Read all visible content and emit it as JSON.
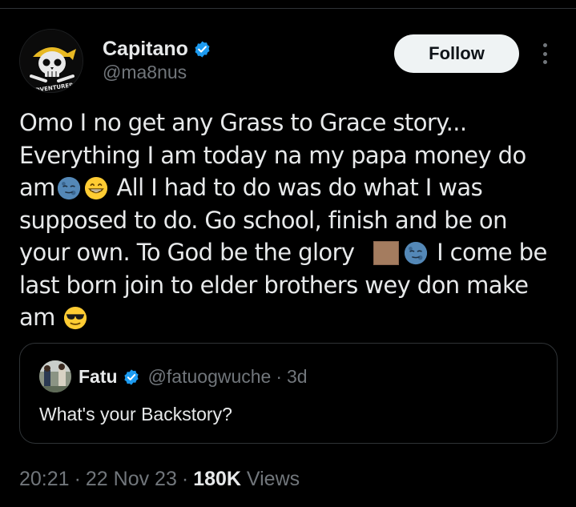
{
  "author": {
    "display_name": "Capitano",
    "handle": "@ma8nus",
    "verified": true,
    "avatar_text": "ADVENTURER"
  },
  "follow_button": {
    "label": "Follow"
  },
  "tweet": {
    "lines": [
      "Omo I no get any Grass to Grace story...",
      "Everything I am today na my papa money do",
      "am",
      " All I had to do was do what I was",
      "supposed to do. Go school, finish and be on",
      "your own. To God be the glory",
      " I come be",
      "last born join to elder brothers wey don make",
      "am"
    ]
  },
  "quote": {
    "display_name": "Fatu",
    "handle": "@fatuogwuche",
    "time": "3d",
    "text": "What's your Backstory?"
  },
  "meta": {
    "time": "20:21",
    "date": "22 Nov 23",
    "views_count": "180K",
    "views_label": "Views",
    "separator": "·"
  },
  "colors": {
    "background": "#000000",
    "text": "#e7e9ea",
    "muted": "#71767b",
    "verified": "#1d9bf0",
    "border": "#2f3336"
  }
}
